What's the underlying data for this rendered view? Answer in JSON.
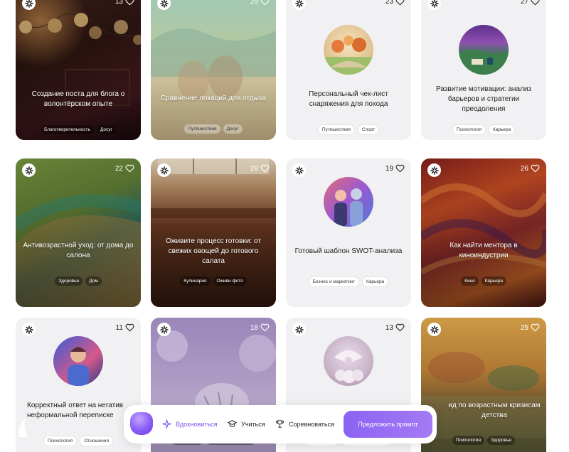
{
  "cards": [
    {
      "likes": "13",
      "title": "Создание поста для блога о волонтёрском опыте",
      "tags": [
        "Благотворительность",
        "Досуг"
      ]
    },
    {
      "likes": "29",
      "title": "Сравнение локаций для отдыха",
      "tags": [
        "Путешествия",
        "Досуг"
      ]
    },
    {
      "likes": "23",
      "title": "Персональный чек-лист снаряжения для похода",
      "tags": [
        "Путешествия",
        "Спорт"
      ]
    },
    {
      "likes": "27",
      "title": "Развитие мотивации: анализ барьеров и стратегии преодоления",
      "tags": [
        "Психология",
        "Карьера"
      ]
    },
    {
      "likes": "22",
      "title": "Антивозрастной уход: от дома до салона",
      "tags": [
        "Здоровье",
        "Дом"
      ]
    },
    {
      "likes": "29",
      "title": "Оживите процесс готовки: от свежих овощей до готового салата",
      "tags": [
        "Кулинария",
        "Оживи фото"
      ]
    },
    {
      "likes": "19",
      "title": "Готовый шаблон SWOT-анализа",
      "tags": [
        "Бизнес и маркетинг",
        "Карьера"
      ]
    },
    {
      "likes": "26",
      "title": "Как найти ментора в киноиндустрии",
      "tags": [
        "Кино",
        "Карьера"
      ]
    },
    {
      "likes": "11",
      "title": "Корректный ответ на негатив неформальной переписке",
      "tags": [
        "Психология",
        "Отношения"
      ]
    },
    {
      "likes": "18",
      "title": "",
      "tags": [
        "Технологии",
        "Бизнес и маркетинг"
      ]
    },
    {
      "likes": "13",
      "title": "",
      "tags": [
        "Технологии",
        "Бизнес и маркетинг"
      ]
    },
    {
      "likes": "25",
      "title": "ид по возрастным кризисам детства",
      "tags": [
        "Психология",
        "Здоровье"
      ]
    }
  ],
  "toolbar": {
    "inspire_label": "Вдохновиться",
    "learn_label": "Учиться",
    "compete_label": "Соревноваться",
    "suggest_label": "Предложить промпт"
  },
  "colors": {
    "accent": "#8b63f2",
    "card_light": "#f1f1f3"
  }
}
